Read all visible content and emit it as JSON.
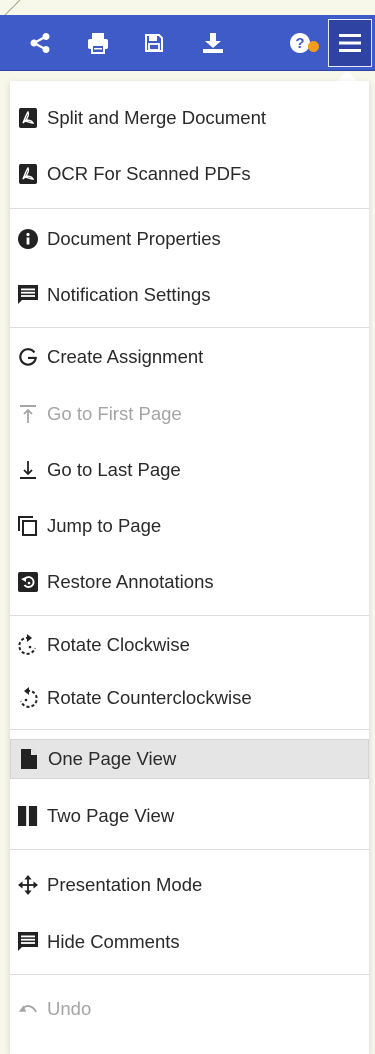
{
  "toolbar": {
    "buttons": [
      {
        "name": "share",
        "icon": "share-icon"
      },
      {
        "name": "print",
        "icon": "print-icon"
      },
      {
        "name": "save",
        "icon": "save-icon"
      },
      {
        "name": "download",
        "icon": "download-icon"
      },
      {
        "name": "help",
        "icon": "help-icon"
      },
      {
        "name": "menu",
        "icon": "hamburger-icon"
      }
    ],
    "badge_color": "#f59c1a",
    "accent": "#3f5bc7"
  },
  "menu": {
    "items": [
      {
        "label": "Split and Merge Document",
        "icon": "pdf-file-icon",
        "disabled": false,
        "active": false
      },
      {
        "label": "OCR For Scanned PDFs",
        "icon": "pdf-file-icon",
        "disabled": false,
        "active": false
      },
      {
        "label": "Document Properties",
        "icon": "info-icon",
        "disabled": false,
        "active": false
      },
      {
        "label": "Notification Settings",
        "icon": "message-icon",
        "disabled": false,
        "active": false
      },
      {
        "label": "Create Assignment",
        "icon": "google-g-icon",
        "disabled": false,
        "active": false
      },
      {
        "label": "Go to First Page",
        "icon": "first-page-icon",
        "disabled": true,
        "active": false
      },
      {
        "label": "Go to Last Page",
        "icon": "last-page-icon",
        "disabled": false,
        "active": false
      },
      {
        "label": "Jump to Page",
        "icon": "jump-pages-icon",
        "disabled": false,
        "active": false
      },
      {
        "label": "Restore Annotations",
        "icon": "restore-icon",
        "disabled": false,
        "active": false
      },
      {
        "label": "Rotate Clockwise",
        "icon": "rotate-cw-icon",
        "disabled": false,
        "active": false
      },
      {
        "label": "Rotate Counterclockwise",
        "icon": "rotate-ccw-icon",
        "disabled": false,
        "active": false
      },
      {
        "label": "One Page View",
        "icon": "single-page-icon",
        "disabled": false,
        "active": true
      },
      {
        "label": "Two Page View",
        "icon": "two-page-icon",
        "disabled": false,
        "active": false
      },
      {
        "label": "Presentation Mode",
        "icon": "move-arrows-icon",
        "disabled": false,
        "active": false
      },
      {
        "label": "Hide Comments",
        "icon": "message-icon",
        "disabled": false,
        "active": false
      },
      {
        "label": "Undo",
        "icon": "undo-icon",
        "disabled": true,
        "active": false
      }
    ]
  }
}
